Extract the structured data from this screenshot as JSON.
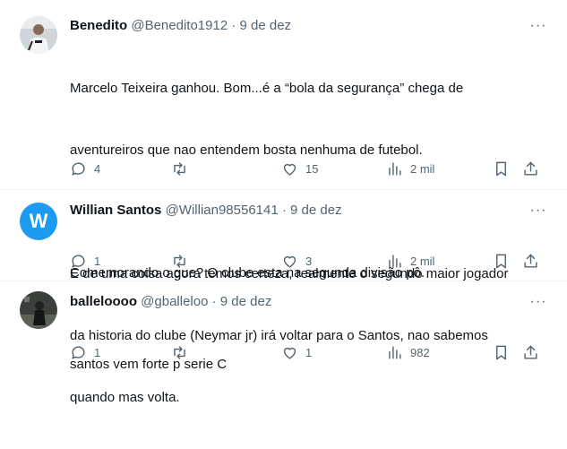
{
  "tweets": [
    {
      "name": "Benedito",
      "handle": "@Benedito1912",
      "sep": "·",
      "date": "9 de dez",
      "lines": [
        "Marcelo Teixeira ganhou. Bom...é a “bola da segurança” chega de",
        "aventureiros que nao entendem bosta nenhuma de futebol.",
        "",
        "E de uma coisa agora temos certeza, realmente o segundo maior jogador",
        "da historia do clube (Neymar jr) irá voltar para o Santos, nao sabemos",
        "quando mas volta."
      ],
      "replies": "4",
      "retweets": "",
      "likes": "15",
      "views": "2 mil",
      "avatar_icon": "profile-photo"
    },
    {
      "name": "Willian Santos",
      "handle": "@Willian98556141",
      "sep": "·",
      "date": "9 de dez",
      "lines": [
        "Comemorando o que? O clube esta na segunda divisão pô."
      ],
      "replies": "1",
      "retweets": "",
      "likes": "3",
      "views": "2 mil",
      "avatar_letter": "W",
      "avatar_color": "#1d9bf0"
    },
    {
      "name": "balleloooo",
      "handle": "@gballeloo",
      "sep": "·",
      "date": "9 de dez",
      "lines": [
        "santos vem forte p serie C"
      ],
      "replies": "1",
      "retweets": "",
      "likes": "1",
      "views": "982",
      "avatar_icon": "profile-photo"
    }
  ],
  "more_label": "···",
  "icons": {
    "reply": "reply-icon",
    "retweet": "retweet-icon",
    "like": "heart-icon",
    "views": "views-icon",
    "bookmark": "bookmark-icon",
    "share": "share-icon"
  }
}
